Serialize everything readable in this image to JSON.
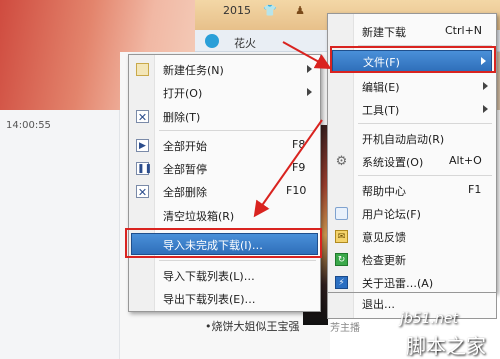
{
  "background": {
    "year": "2015",
    "tab_label": "花火",
    "time": "14:00:55",
    "list_item": "•烧饼大姐似王宝强",
    "list_sub": "芳主播"
  },
  "context_menu": {
    "items": [
      {
        "label": "新建任务(N)",
        "shortcut": "",
        "icon": "new-task-icon",
        "submenu": true
      },
      {
        "label": "打开(O)",
        "shortcut": "",
        "icon": "",
        "submenu": true
      },
      {
        "label": "删除(T)",
        "shortcut": "",
        "icon": "delete-icon",
        "submenu": false
      },
      {
        "label": "全部开始",
        "shortcut": "F8",
        "icon": "play-icon",
        "submenu": false
      },
      {
        "label": "全部暂停",
        "shortcut": "F9",
        "icon": "pause-icon",
        "submenu": false
      },
      {
        "label": "全部删除",
        "shortcut": "F10",
        "icon": "delete-all-icon",
        "submenu": false
      },
      {
        "label": "清空垃圾箱(R)",
        "shortcut": "",
        "icon": "",
        "submenu": false
      },
      {
        "label": "导入未完成下载(I)…",
        "shortcut": "",
        "icon": "",
        "submenu": false,
        "highlighted": true
      },
      {
        "label": "导入下载列表(L)…",
        "shortcut": "",
        "icon": "",
        "submenu": false
      },
      {
        "label": "导出下载列表(E)…",
        "shortcut": "",
        "icon": "",
        "submenu": false
      }
    ]
  },
  "main_menu": {
    "items": [
      {
        "label": "新建下载",
        "shortcut": "Ctrl+N",
        "icon": ""
      },
      {
        "label": "文件(F)",
        "shortcut": "",
        "icon": "",
        "submenu": true,
        "highlighted": true
      },
      {
        "label": "编辑(E)",
        "shortcut": "",
        "icon": "",
        "submenu": true
      },
      {
        "label": "工具(T)",
        "shortcut": "",
        "icon": "",
        "submenu": true
      },
      {
        "label": "开机自动启动(R)",
        "shortcut": "",
        "icon": ""
      },
      {
        "label": "系统设置(O)",
        "shortcut": "Alt+O",
        "icon": "gear-icon"
      },
      {
        "label": "帮助中心",
        "shortcut": "F1",
        "icon": ""
      },
      {
        "label": "用户论坛(F)",
        "shortcut": "",
        "icon": "forum-icon"
      },
      {
        "label": "意见反馈",
        "shortcut": "",
        "icon": "mail-icon"
      },
      {
        "label": "检查更新",
        "shortcut": "",
        "icon": "update-icon"
      },
      {
        "label": "关于迅雷…(A)",
        "shortcut": "",
        "icon": "about-icon"
      },
      {
        "label": "退出…",
        "shortcut": "",
        "icon": ""
      }
    ]
  },
  "watermark": {
    "line1": "jb51.net",
    "line2": "脚本之家"
  },
  "colors": {
    "highlight": "#2f6fba",
    "red_annotation": "#d9231f"
  }
}
